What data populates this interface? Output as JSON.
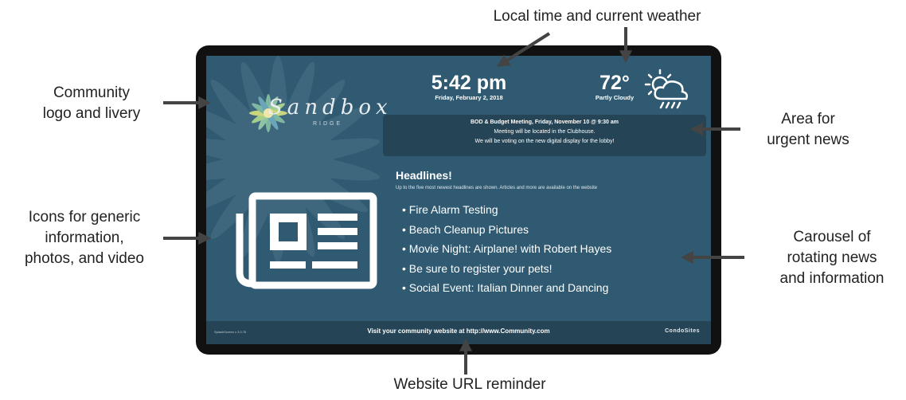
{
  "callouts": {
    "time_weather": "Local time and current weather",
    "logo": [
      "Community",
      "logo and livery"
    ],
    "urgent": [
      "Area for",
      "urgent news"
    ],
    "icons": [
      "Icons for generic",
      "information,",
      "photos, and video"
    ],
    "carousel": [
      "Carousel of",
      "rotating news",
      "and information"
    ],
    "website": "Website URL reminder"
  },
  "screen": {
    "logo_text": "Sandbox",
    "logo_sub": "RIDGE",
    "time": "5:42 pm",
    "date": "Friday, February 2, 2018",
    "temperature": "72°",
    "weather": "Partly Cloudy",
    "weather_icon": "partly-cloudy-rain-icon",
    "urgent_lines": [
      "BOD & Budget Meeting, Friday, November 10 @ 9:30 am",
      "Meeting will be located in the Clubhouse.",
      "We will be voting on the new digital display for the lobby!"
    ],
    "headlines_title": "Headlines!",
    "headlines_subtitle": "Up to the five most newest headlines are shown. Articles and more are available on the website",
    "headlines": [
      "• Fire Alarm Testing",
      "• Beach Cleanup Pictures",
      "• Movie Night: Airplane! with Robert Hayes",
      "• Be sure to register your pets!",
      "• Social Event: Italian Dinner and Dancing"
    ],
    "news_icon": "newspaper-icon",
    "footer_url": "Visit your community website at http://www.Community.com",
    "footer_left": "SplashScreen v 3.0.76",
    "footer_brand": "CondoSites"
  },
  "colors": {
    "screen_bg": "#2f5a72",
    "bezel": "#111111",
    "footer_bg": "#254456",
    "arrow": "#333333"
  }
}
